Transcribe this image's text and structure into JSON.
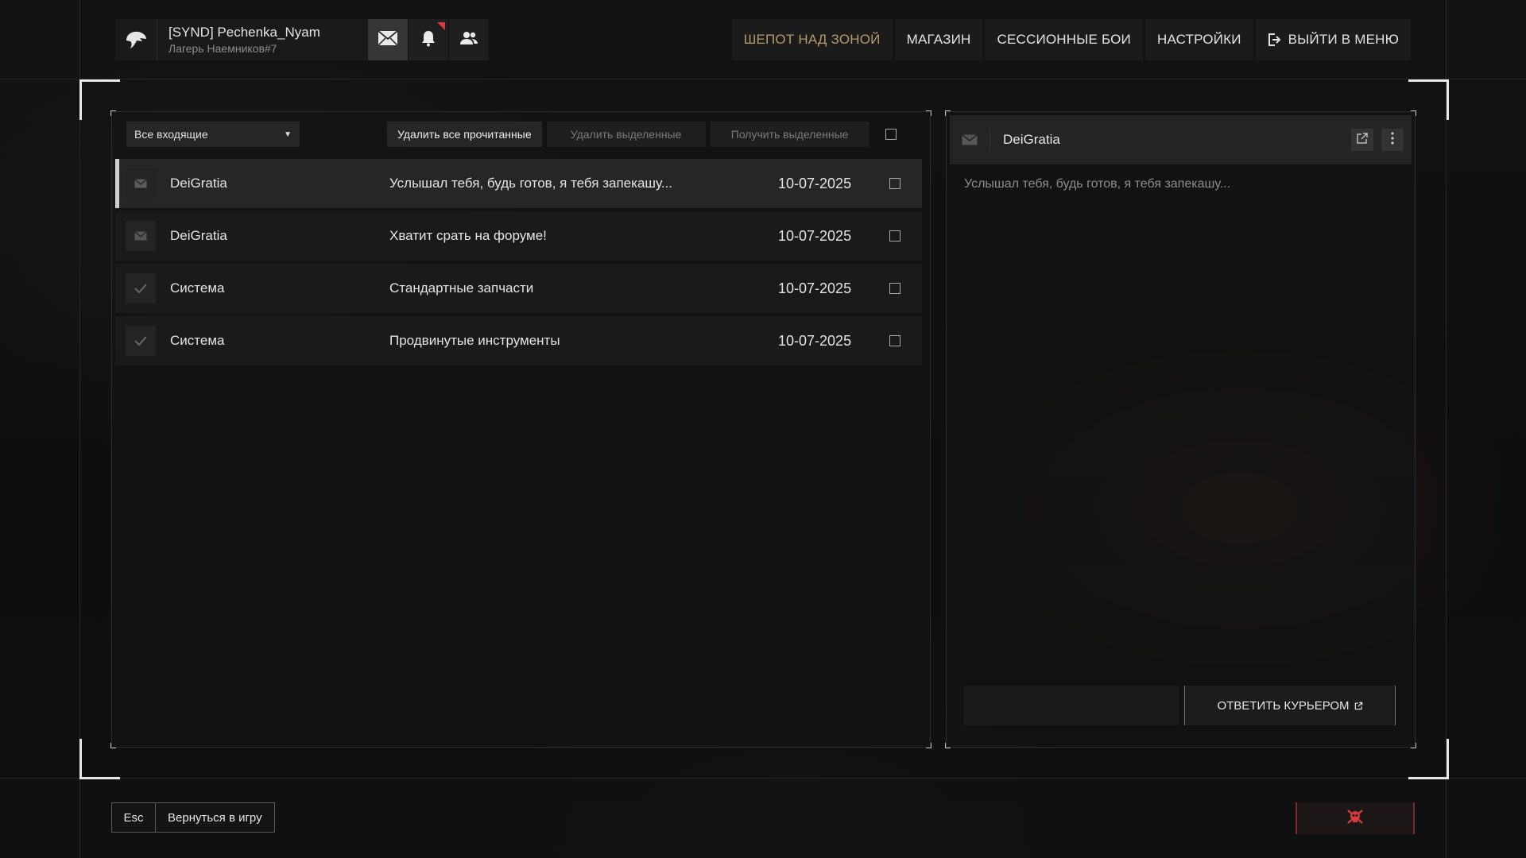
{
  "profile": {
    "name": "[SYND] Pechenka_Nyam",
    "subtitle": "Лагерь Наемников#7"
  },
  "nav": {
    "items": [
      {
        "label": "ШЕПОТ НАД ЗОНОЙ",
        "active": true
      },
      {
        "label": "МАГАЗИН"
      },
      {
        "label": "СЕССИОННЫЕ БОИ"
      },
      {
        "label": "НАСТРОЙКИ"
      },
      {
        "label": "ВЫЙТИ В МЕНЮ",
        "icon": "exit-icon"
      }
    ]
  },
  "mail": {
    "filter": "Все входящие",
    "actions": {
      "delete_read": "Удалить все прочитанные",
      "delete_selected": "Удалить выделенные",
      "get_selected": "Получить выделенные"
    },
    "messages": [
      {
        "sender": "DeiGratia",
        "subject": "Услышал тебя, будь готов, я тебя запекашу...",
        "date": "10-07-2025",
        "icon": "envelope-icon"
      },
      {
        "sender": "DeiGratia",
        "subject": "Хватит срать на форуме!",
        "date": "10-07-2025",
        "icon": "envelope-icon"
      },
      {
        "sender": "Система",
        "subject": "Стандартные запчасти",
        "date": "10-07-2025",
        "icon": "check-icon"
      },
      {
        "sender": "Система",
        "subject": "Продвинутые инструменты",
        "date": "10-07-2025",
        "icon": "check-icon"
      }
    ]
  },
  "reader": {
    "title": "DeiGratia",
    "body": "Услышал тебя, будь готов, я тебя запекашу...",
    "reply_label": "ОТВЕТИТЬ КУРЬЕРОМ"
  },
  "footer": {
    "esc_key": "Esc",
    "back_label": "Вернуться в игру"
  },
  "colors": {
    "accent_active": "#b59a6a",
    "danger": "#d83b3b"
  }
}
